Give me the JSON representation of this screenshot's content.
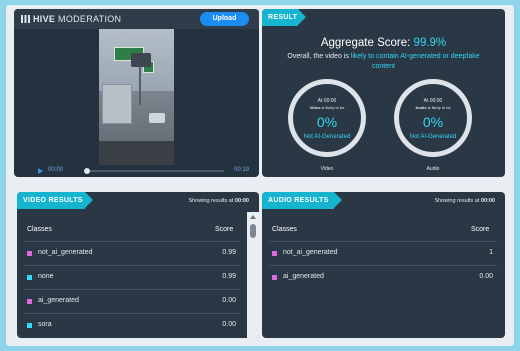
{
  "header": {
    "logo_bold": "HIVE",
    "logo_light": " MODERATION",
    "upload_label": "Upload"
  },
  "player": {
    "current_time": "00:00",
    "duration": "00:19",
    "progress": 0
  },
  "result": {
    "tag": "RESULT",
    "agg_label": "Aggregate Score:",
    "agg_value": "99.9%",
    "sub_prefix": "Overall, the video is ",
    "sub_highlight": "likely to contain AI-generated or deepfake content",
    "gauges": [
      {
        "time": "At 00:00",
        "likely_bold": "Video",
        "likely_rest": " is likely to be",
        "pct": "0%",
        "label": "Not AI-Generated",
        "caption": "Video"
      },
      {
        "time": "At 00:00",
        "likely_bold": "Audio",
        "likely_rest": " is likely to be",
        "pct": "0%",
        "label": "Not AI-Generated",
        "caption": "Audio"
      }
    ]
  },
  "video_results": {
    "tag": "VIDEO RESULTS",
    "showing_prefix": "Showing results at ",
    "showing_time": "00:00",
    "col_classes": "Classes",
    "col_score": "Score",
    "rows": [
      {
        "name": "not_ai_generated",
        "score": "0.99",
        "color": "#d66ad6"
      },
      {
        "name": "none",
        "score": "0.99",
        "color": "#35d7f2"
      },
      {
        "name": "ai_generated",
        "score": "0.00",
        "color": "#d66ad6"
      },
      {
        "name": "sora",
        "score": "0.00",
        "color": "#35d7f2"
      }
    ]
  },
  "audio_results": {
    "tag": "AUDIO RESULTS",
    "showing_prefix": "Showing results at ",
    "showing_time": "00:00",
    "col_classes": "Classes",
    "col_score": "Score",
    "rows": [
      {
        "name": "not_ai_generated",
        "score": "1",
        "color": "#d66ad6"
      },
      {
        "name": "ai_generated",
        "score": "0.00",
        "color": "#d66ad6"
      }
    ]
  },
  "colors": {
    "accent": "#35d7f2",
    "tag": "#16b4cf",
    "upload": "#1b8df2",
    "panel": "#2a3744",
    "background": "#8ed5ea"
  }
}
